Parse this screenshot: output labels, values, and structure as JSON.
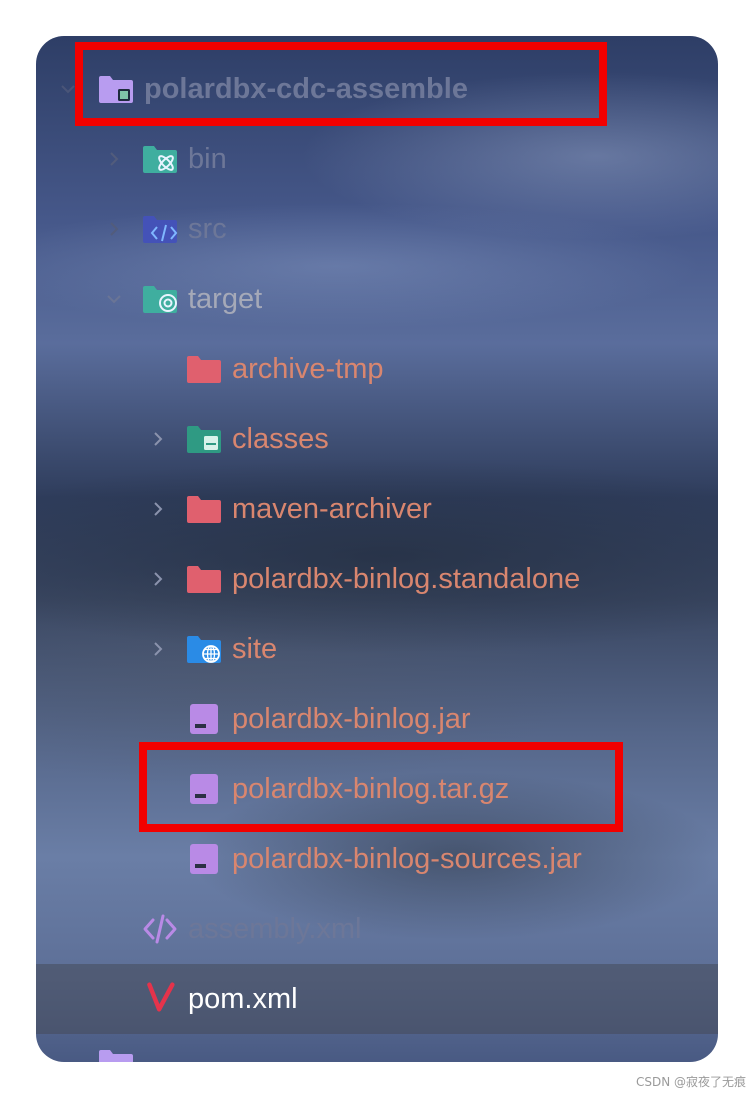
{
  "tree": {
    "root": {
      "label": "polardbx-cdc-assemble",
      "expanded": true,
      "icon": "module-folder-icon",
      "color": "#b89cf0"
    },
    "items": [
      {
        "label": "bin",
        "expanded": false,
        "icon": "bin-folder-icon"
      },
      {
        "label": "src",
        "expanded": false,
        "icon": "src-folder-icon"
      },
      {
        "label": "target",
        "expanded": true,
        "icon": "target-folder-icon"
      },
      {
        "label": "archive-tmp",
        "icon": "folder-icon"
      },
      {
        "label": "classes",
        "expanded": false,
        "icon": "classes-folder-icon"
      },
      {
        "label": "maven-archiver",
        "expanded": false,
        "icon": "folder-icon"
      },
      {
        "label": "polardbx-binlog.standalone",
        "expanded": false,
        "icon": "folder-icon"
      },
      {
        "label": "site",
        "expanded": false,
        "icon": "site-folder-icon"
      },
      {
        "label": "polardbx-binlog.jar",
        "icon": "archive-file-icon"
      },
      {
        "label": "polardbx-binlog.tar.gz",
        "icon": "archive-file-icon"
      },
      {
        "label": "polardbx-binlog-sources.jar",
        "icon": "archive-file-icon"
      },
      {
        "label": "assembly.xml",
        "icon": "xml-file-icon"
      },
      {
        "label": "pom.xml",
        "icon": "maven-icon",
        "selected": true
      }
    ]
  },
  "colors": {
    "highlight_border": "#f20000",
    "folder_pink": "#e0606e",
    "folder_teal": "#3fae9f",
    "folder_blue": "#2a8be6",
    "file_purple": "#b98ae6",
    "label_salmon": "#d9866f",
    "maven_red": "#e5334b"
  },
  "watermark": "CSDN @寂夜了无痕"
}
